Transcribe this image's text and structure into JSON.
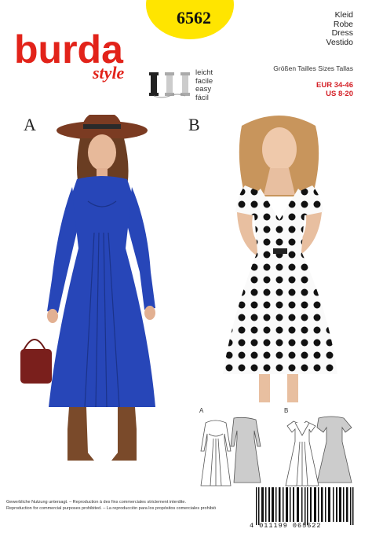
{
  "header": {
    "brand": "burda",
    "brand_sub": "style",
    "pattern_number": "6562",
    "difficulty": [
      "leicht",
      "facile",
      "easy",
      "fácil"
    ],
    "garment_type": [
      "Kleid",
      "Robe",
      "Dress",
      "Vestido"
    ],
    "sizes_heading": "Größen Tailles Sizes Tallas",
    "size_eur": "EUR 34-46",
    "size_us": "US 8-20"
  },
  "views": {
    "a_label": "A",
    "b_label": "B",
    "drawing_a_label": "A",
    "drawing_b_label": "B"
  },
  "footer": {
    "line1": "Gewerbliche Nutzung untersagt. – Reproduction à des fins commerciales strictement interdite.",
    "line2": "Reproduction for commercial purposes prohibited. – La reproducción para los propósitos comerciales prohibió"
  },
  "barcode": {
    "digits": "4 011199 065622"
  },
  "colors": {
    "brand_red": "#e2231a",
    "circle_yellow": "#ffe500",
    "size_red": "#d41f26",
    "dress_a_blue": "#2746b8"
  }
}
